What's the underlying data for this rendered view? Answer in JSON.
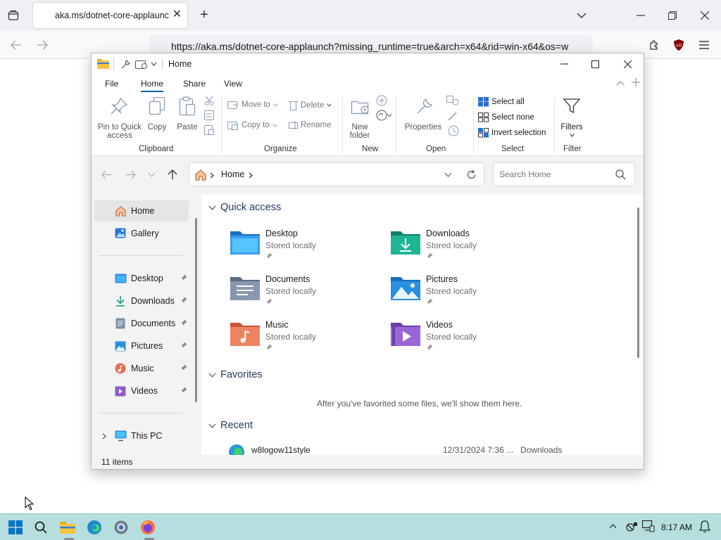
{
  "browser": {
    "tab_title": "aka.ms/dotnet-core-applaunch",
    "tab_close": "✕",
    "new_tab": "+",
    "url": "https://aka.ms/dotnet-core-applaunch?missing_runtime=true&arch=x64&rid=win-x64&os=w"
  },
  "explorer": {
    "title": "Home",
    "ribbon_tabs": [
      "File",
      "Home",
      "Share",
      "View"
    ],
    "clipboard": {
      "pin": "Pin to Quick access",
      "pin_l1": "Pin to Quick",
      "pin_l2": "access",
      "copy": "Copy",
      "paste": "Paste",
      "label": "Clipboard"
    },
    "organize": {
      "move_to": "Move to",
      "copy_to": "Copy to",
      "delete": "Delete",
      "rename": "Rename",
      "label": "Organize"
    },
    "new": {
      "new_l1": "New",
      "new_l2": "folder",
      "label": "New"
    },
    "open": {
      "properties": "Properties",
      "label": "Open"
    },
    "select": {
      "select_all": "Select all",
      "select_none": "Select none",
      "invert": "Invert selection",
      "label": "Select"
    },
    "filter": {
      "filters": "Filters",
      "label": "Filter"
    },
    "address": {
      "crumb": "Home",
      "search_placeholder": "Search Home"
    },
    "nav": {
      "home": "Home",
      "gallery": "Gallery",
      "pinned": [
        "Desktop",
        "Downloads",
        "Documents",
        "Pictures",
        "Music",
        "Videos"
      ],
      "this_pc": "This PC"
    },
    "quick_access": {
      "heading": "Quick access",
      "items": [
        {
          "name": "Desktop",
          "sub": "Stored locally"
        },
        {
          "name": "Downloads",
          "sub": "Stored locally"
        },
        {
          "name": "Documents",
          "sub": "Stored locally"
        },
        {
          "name": "Pictures",
          "sub": "Stored locally"
        },
        {
          "name": "Music",
          "sub": "Stored locally"
        },
        {
          "name": "Videos",
          "sub": "Stored locally"
        }
      ]
    },
    "favorites": {
      "heading": "Favorites",
      "empty_text": "After you've favorited some files, we'll show them here."
    },
    "recent": {
      "heading": "Recent",
      "row": {
        "name": "w8logow11style",
        "date": "12/31/2024 7:36 ...",
        "location": "Downloads"
      }
    },
    "status": "11 items"
  },
  "taskbar": {
    "time": "8:17 AM"
  },
  "colors": {
    "accent": "#005fb8",
    "taskbar": "#b6dede",
    "folder_blue": "#3a8ad8",
    "folder_teal": "#1fa58a",
    "folder_gray": "#7d8fa8",
    "folder_orange": "#e87b55",
    "folder_purple": "#8b5cc8"
  }
}
